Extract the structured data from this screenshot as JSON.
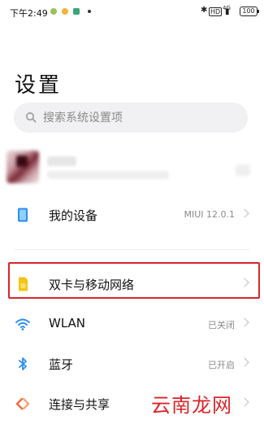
{
  "status_bar": {
    "time": "下午2:49",
    "battery": "100",
    "network_label": "4G"
  },
  "page": {
    "title": "设置"
  },
  "search": {
    "placeholder": "搜索系统设置项"
  },
  "items": [
    {
      "label": "我的设备",
      "value": "MIUI 12.0.1",
      "icon": "device-icon"
    },
    {
      "label": "双卡与移动网络",
      "value": "",
      "icon": "sim-card-icon"
    },
    {
      "label": "WLAN",
      "value": "已关闭",
      "icon": "wifi-icon"
    },
    {
      "label": "蓝牙",
      "value": "已开启",
      "icon": "bluetooth-icon"
    },
    {
      "label": "连接与共享",
      "value": "",
      "icon": "connection-share-icon"
    }
  ],
  "colors": {
    "highlight": "#d9262a",
    "accent_blue": "#2c8ef0",
    "sim_yellow": "#f5c518",
    "share_orange": "#f26b3a"
  },
  "watermark": "云南龙网"
}
